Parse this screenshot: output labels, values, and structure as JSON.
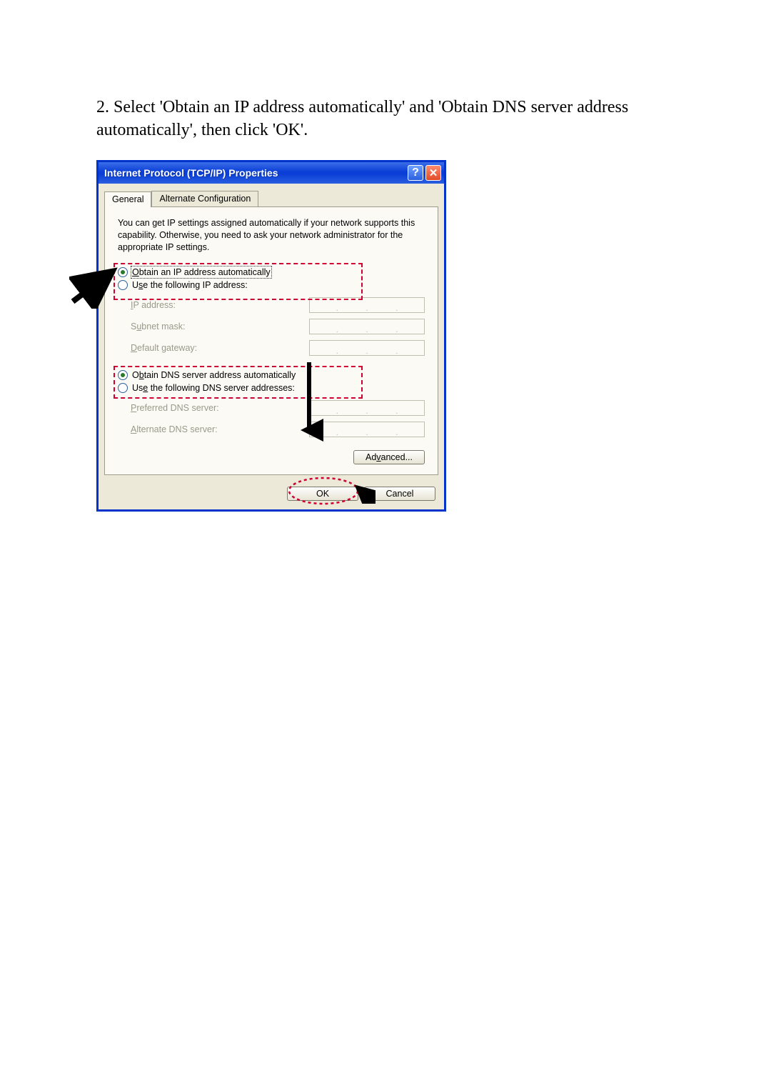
{
  "instruction": "2. Select 'Obtain an IP address automatically' and 'Obtain DNS server address automatically', then click 'OK'.",
  "dialog": {
    "title": "Internet Protocol (TCP/IP) Properties",
    "help_glyph": "?",
    "close_glyph": "✕",
    "tabs": {
      "general": "General",
      "alt": "Alternate Configuration"
    },
    "description": "You can get IP settings assigned automatically if your network supports this capability. Otherwise, you need to ask your network administrator for the appropriate IP settings.",
    "radios": {
      "obtain_ip": "Obtain an IP address automatically",
      "use_ip": "Use the following IP address:",
      "obtain_dns": "Obtain DNS server address automatically",
      "use_dns": "Use the following DNS server addresses:"
    },
    "fields": {
      "ip": "IP address:",
      "subnet": "Subnet mask:",
      "gateway": "Default gateway:",
      "pref_dns": "Preferred DNS server:",
      "alt_dns": "Alternate DNS server:"
    },
    "dot": ".",
    "buttons": {
      "advanced": "Advanced...",
      "ok": "OK",
      "cancel": "Cancel"
    }
  }
}
